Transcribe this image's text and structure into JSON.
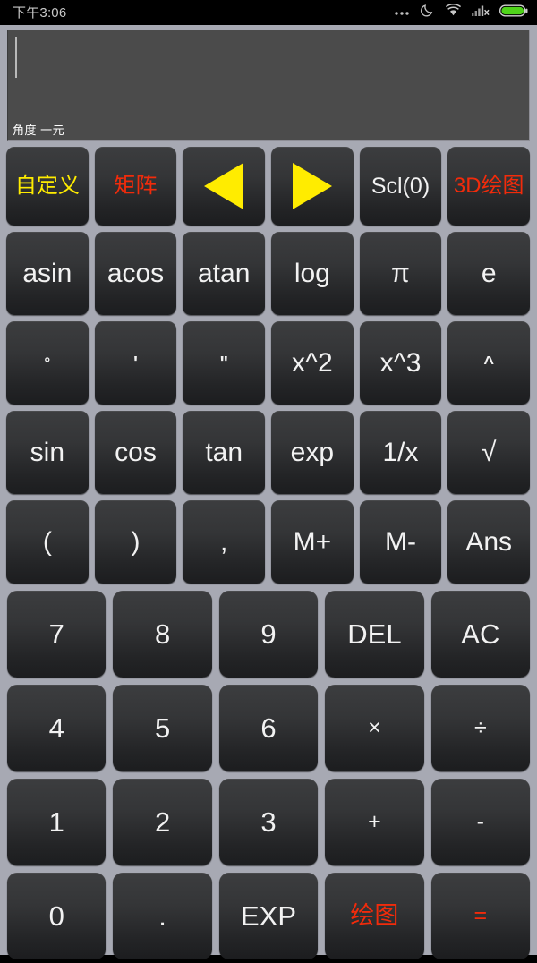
{
  "status_bar": {
    "time": "下午3:06",
    "icons": [
      {
        "name": "more-dots-icon",
        "glyph": "•••"
      },
      {
        "name": "do-not-disturb-moon-icon",
        "glyph": "moon"
      },
      {
        "name": "wifi-icon",
        "glyph": "wifi"
      },
      {
        "name": "cellular-signal-no-sim-icon",
        "glyph": "signal-x"
      },
      {
        "name": "battery-icon",
        "glyph": "battery",
        "color": "#4fd41a"
      }
    ]
  },
  "display": {
    "expression": "",
    "status_line": "角度 一元",
    "caret_visible": true
  },
  "colors": {
    "app_background": "#a7a9b3",
    "key_face": "#2c2d2f",
    "text_white": "#f2f2f2",
    "text_yellow": "#ffec00",
    "text_red": "#f22b0b",
    "display_background": "#4b4b4b",
    "battery_green": "#4fd41a"
  },
  "keypad": {
    "function_rows": [
      [
        {
          "name": "key-custom",
          "label": "自定义",
          "color": "yellow",
          "type": "cjk"
        },
        {
          "name": "key-matrix",
          "label": "矩阵",
          "color": "red",
          "type": "cjk"
        },
        {
          "name": "key-cursor-left",
          "label": "◀",
          "color": "yellow",
          "type": "arrow-left"
        },
        {
          "name": "key-cursor-right",
          "label": "▶",
          "color": "yellow",
          "type": "arrow-right"
        },
        {
          "name": "key-scl",
          "label": "Scl(0)",
          "color": "white",
          "type": "small"
        },
        {
          "name": "key-3d-plot",
          "label": "3D绘图",
          "color": "red",
          "type": "cjk"
        }
      ],
      [
        {
          "name": "key-asin",
          "label": "asin",
          "color": "white",
          "type": "text"
        },
        {
          "name": "key-acos",
          "label": "acos",
          "color": "white",
          "type": "text"
        },
        {
          "name": "key-atan",
          "label": "atan",
          "color": "white",
          "type": "text"
        },
        {
          "name": "key-log",
          "label": "log",
          "color": "white",
          "type": "text"
        },
        {
          "name": "key-pi",
          "label": "π",
          "color": "white",
          "type": "text"
        },
        {
          "name": "key-e",
          "label": "e",
          "color": "white",
          "type": "text"
        }
      ],
      [
        {
          "name": "key-degree",
          "label": "°",
          "color": "white",
          "type": "tiny"
        },
        {
          "name": "key-minute",
          "label": "'",
          "color": "white",
          "type": "tiny2"
        },
        {
          "name": "key-second",
          "label": "\"",
          "color": "white",
          "type": "tiny2"
        },
        {
          "name": "key-square",
          "label": "x^2",
          "color": "white",
          "type": "text"
        },
        {
          "name": "key-cube",
          "label": "x^3",
          "color": "white",
          "type": "text"
        },
        {
          "name": "key-power",
          "label": "^",
          "color": "white",
          "type": "tiny2"
        }
      ],
      [
        {
          "name": "key-sin",
          "label": "sin",
          "color": "white",
          "type": "text"
        },
        {
          "name": "key-cos",
          "label": "cos",
          "color": "white",
          "type": "text"
        },
        {
          "name": "key-tan",
          "label": "tan",
          "color": "white",
          "type": "text"
        },
        {
          "name": "key-exp",
          "label": "exp",
          "color": "white",
          "type": "text"
        },
        {
          "name": "key-reciprocal",
          "label": "1/x",
          "color": "white",
          "type": "text"
        },
        {
          "name": "key-sqrt",
          "label": "√",
          "color": "white",
          "type": "text"
        }
      ],
      [
        {
          "name": "key-paren-open",
          "label": "(",
          "color": "white",
          "type": "text"
        },
        {
          "name": "key-paren-close",
          "label": ")",
          "color": "white",
          "type": "text"
        },
        {
          "name": "key-comma",
          "label": ",",
          "color": "white",
          "type": "text"
        },
        {
          "name": "key-memory-add",
          "label": "M+",
          "color": "white",
          "type": "text"
        },
        {
          "name": "key-memory-sub",
          "label": "M-",
          "color": "white",
          "type": "text"
        },
        {
          "name": "key-answer",
          "label": "Ans",
          "color": "white",
          "type": "text"
        }
      ]
    ],
    "numeric_rows": [
      [
        {
          "name": "key-7",
          "label": "7",
          "color": "white",
          "type": "text"
        },
        {
          "name": "key-8",
          "label": "8",
          "color": "white",
          "type": "text"
        },
        {
          "name": "key-9",
          "label": "9",
          "color": "white",
          "type": "text"
        },
        {
          "name": "key-delete",
          "label": "DEL",
          "color": "white",
          "type": "text"
        },
        {
          "name": "key-all-clear",
          "label": "AC",
          "color": "white",
          "type": "text"
        }
      ],
      [
        {
          "name": "key-4",
          "label": "4",
          "color": "white",
          "type": "text"
        },
        {
          "name": "key-5",
          "label": "5",
          "color": "white",
          "type": "text"
        },
        {
          "name": "key-6",
          "label": "6",
          "color": "white",
          "type": "text"
        },
        {
          "name": "key-multiply",
          "label": "×",
          "color": "white",
          "type": "small"
        },
        {
          "name": "key-divide",
          "label": "÷",
          "color": "white",
          "type": "small"
        }
      ],
      [
        {
          "name": "key-1",
          "label": "1",
          "color": "white",
          "type": "text"
        },
        {
          "name": "key-2",
          "label": "2",
          "color": "white",
          "type": "text"
        },
        {
          "name": "key-3",
          "label": "3",
          "color": "white",
          "type": "text"
        },
        {
          "name": "key-plus",
          "label": "+",
          "color": "white",
          "type": "small"
        },
        {
          "name": "key-minus",
          "label": "-",
          "color": "white",
          "type": "small"
        }
      ],
      [
        {
          "name": "key-0",
          "label": "0",
          "color": "white",
          "type": "text"
        },
        {
          "name": "key-decimal",
          "label": ".",
          "color": "white",
          "type": "text"
        },
        {
          "name": "key-exponent",
          "label": "EXP",
          "color": "white",
          "type": "text"
        },
        {
          "name": "key-plot",
          "label": "绘图",
          "color": "red",
          "type": "cjk"
        },
        {
          "name": "key-equals",
          "label": "=",
          "color": "red",
          "type": "small"
        }
      ]
    ]
  }
}
